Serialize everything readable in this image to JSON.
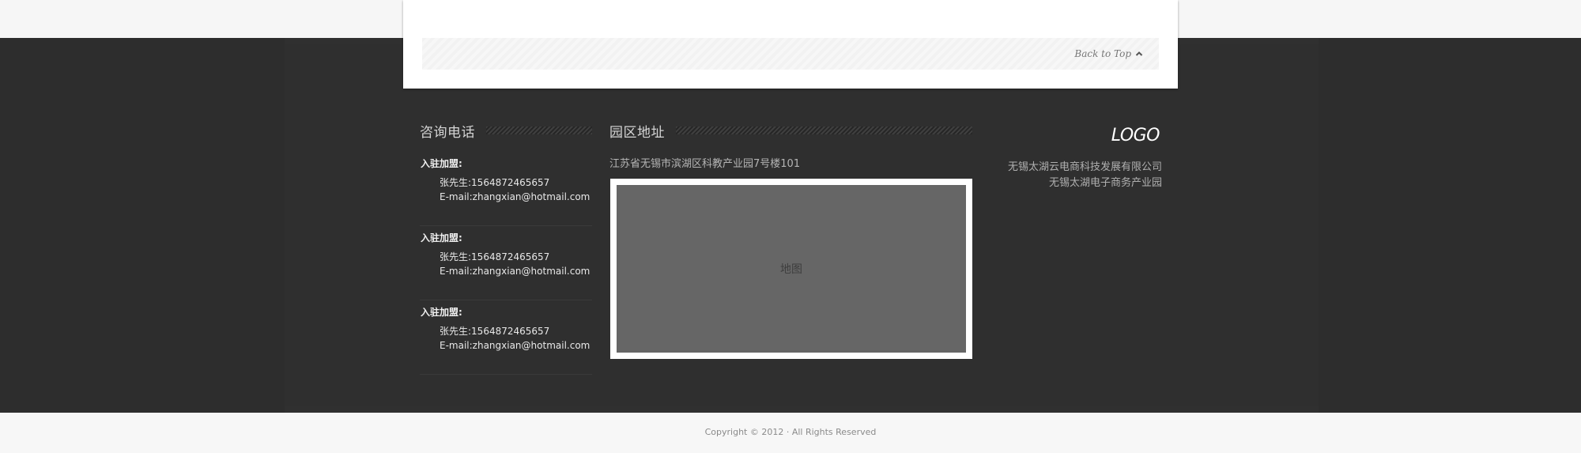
{
  "card": {
    "back_to_top": "Back to Top"
  },
  "contact": {
    "heading": "咨询电话",
    "items": [
      {
        "label": "入驻加盟:",
        "phone": "张先生:1564872465657",
        "email": "E-mail:zhangxian@hotmail.com"
      },
      {
        "label": "入驻加盟:",
        "phone": "张先生:1564872465657",
        "email": "E-mail:zhangxian@hotmail.com"
      },
      {
        "label": "入驻加盟:",
        "phone": "张先生:1564872465657",
        "email": "E-mail:zhangxian@hotmail.com"
      }
    ]
  },
  "address": {
    "heading": "园区地址",
    "text": "江苏省无锡市滨湖区科教产业园7号楼101",
    "map_label": "地图"
  },
  "brand": {
    "logo": "LOGO",
    "line1": "无锡太湖云电商科技发展有限公司",
    "line2": "无锡太湖电子商务产业园"
  },
  "footer": {
    "copyright": "Copyright © 2012 · All Rights Reserved"
  },
  "colors": {
    "dark_band": "#2d2d2d",
    "card": "#ffffff",
    "map": "#666666"
  },
  "icons": {
    "back_to_top": "chevron-up-icon"
  }
}
